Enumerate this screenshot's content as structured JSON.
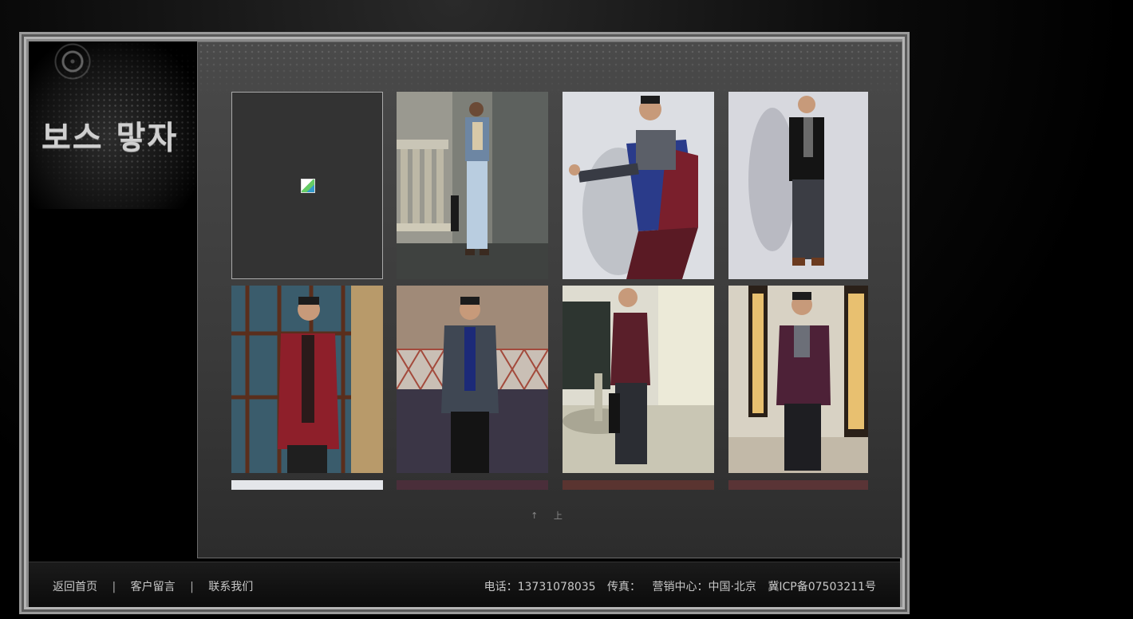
{
  "brand": {
    "logo_text": "보스 맣자"
  },
  "gallery": {
    "rows": [
      [
        {
          "alt": "",
          "broken": true
        },
        {
          "alt": ""
        },
        {
          "alt": ""
        },
        {
          "alt": ""
        }
      ],
      [
        {
          "alt": ""
        },
        {
          "alt": ""
        },
        {
          "alt": ""
        },
        {
          "alt": ""
        }
      ]
    ],
    "pager_label": "↑ 上"
  },
  "footer": {
    "links": [
      "返回首页",
      "客户留言",
      "联系我们"
    ],
    "separator": "|",
    "phone": "电话：13731078035",
    "fax": "传真：",
    "center": "营销中心：中国·北京",
    "icp": "冀ICP备07503211号"
  },
  "colors": {
    "background": "#000000",
    "frame": "#9a9a9a",
    "panel": "#3a3a3a",
    "text": "#c8c8c8"
  }
}
